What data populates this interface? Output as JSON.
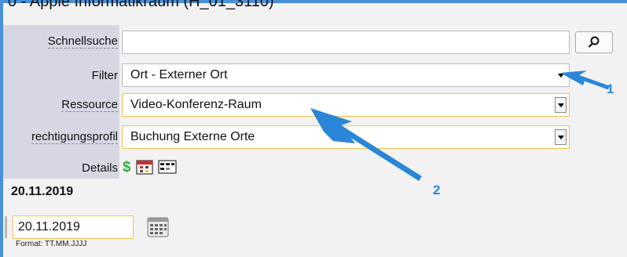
{
  "window": {
    "title": "0 - Apple Informatikraum (H_01_3110)"
  },
  "form": {
    "quicksearch": {
      "label": "Schnellsuche",
      "value": "",
      "search_icon": "magnifier-icon"
    },
    "filter": {
      "label": "Filter",
      "value": "Ort - Externer Ort"
    },
    "resource": {
      "label": "Ressource",
      "value": "Video-Konferenz-Raum"
    },
    "profile": {
      "label": "rechtigungsprofil",
      "value": "Buchung Externe Orte"
    },
    "details": {
      "label": "Details",
      "icons": [
        "dollar-icon",
        "calendar-icon",
        "grid-icon"
      ]
    }
  },
  "date": {
    "heading": "20.11.2019",
    "input_value": "20.11.2019",
    "format_hint": "Format: TT.MM.JJJJ",
    "calendar_icon": "calendar-icon"
  },
  "annotations": {
    "arrow1_label": "1",
    "arrow2_label": "2",
    "arrow_color": "#2a86d7"
  }
}
